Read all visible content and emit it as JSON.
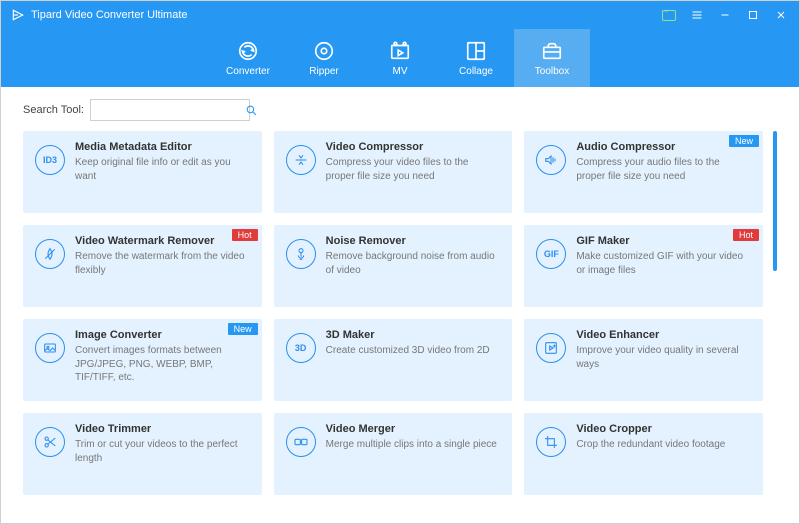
{
  "app": {
    "title": "Tipard Video Converter Ultimate"
  },
  "toolbar": {
    "items": [
      {
        "label": "Converter"
      },
      {
        "label": "Ripper"
      },
      {
        "label": "MV"
      },
      {
        "label": "Collage"
      },
      {
        "label": "Toolbox"
      }
    ],
    "active_index": 4
  },
  "search": {
    "label": "Search Tool:",
    "value": ""
  },
  "badges": {
    "new": "New",
    "hot": "Hot"
  },
  "tools": [
    {
      "icon": "ID3",
      "title": "Media Metadata Editor",
      "desc": "Keep original file info or edit as you want",
      "badge": null
    },
    {
      "icon": "compress",
      "title": "Video Compressor",
      "desc": "Compress your video files to the proper file size you need",
      "badge": null
    },
    {
      "icon": "audio-compress",
      "title": "Audio Compressor",
      "desc": "Compress your audio files to the proper file size you need",
      "badge": "new"
    },
    {
      "icon": "no-watermark",
      "title": "Video Watermark Remover",
      "desc": "Remove the watermark from the video flexibly",
      "badge": "hot"
    },
    {
      "icon": "noise",
      "title": "Noise Remover",
      "desc": "Remove background noise from audio of video",
      "badge": null
    },
    {
      "icon": "GIF",
      "title": "GIF Maker",
      "desc": "Make customized GIF with your video or image files",
      "badge": "hot"
    },
    {
      "icon": "image-convert",
      "title": "Image Converter",
      "desc": "Convert images formats between JPG/JPEG, PNG, WEBP, BMP, TIF/TIFF, etc.",
      "badge": "new"
    },
    {
      "icon": "3D",
      "title": "3D Maker",
      "desc": "Create customized 3D video from 2D",
      "badge": null
    },
    {
      "icon": "enhance",
      "title": "Video Enhancer",
      "desc": "Improve your video quality in several ways",
      "badge": null
    },
    {
      "icon": "scissors",
      "title": "Video Trimmer",
      "desc": "Trim or cut your videos to the perfect length",
      "badge": null
    },
    {
      "icon": "merge",
      "title": "Video Merger",
      "desc": "Merge multiple clips into a single piece",
      "badge": null
    },
    {
      "icon": "crop",
      "title": "Video Cropper",
      "desc": "Crop the redundant video footage",
      "badge": null
    }
  ]
}
